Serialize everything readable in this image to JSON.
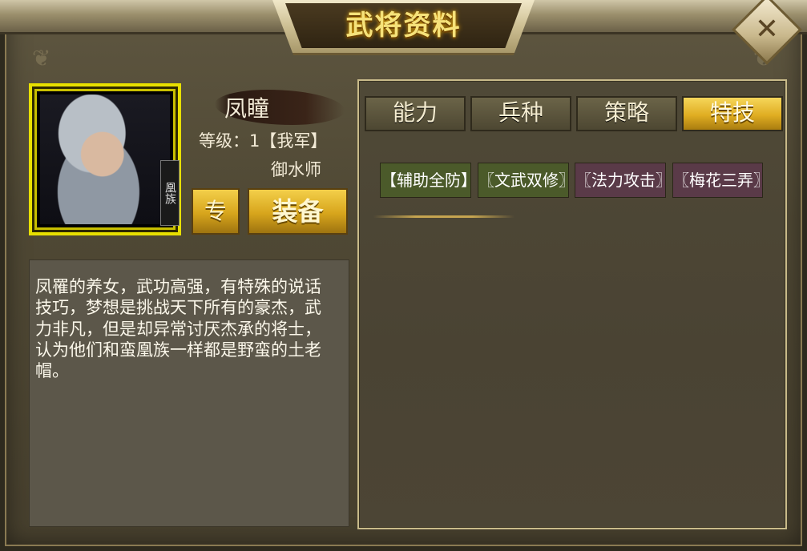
{
  "window": {
    "title": "武将资料",
    "close_icon": "close-x-icon"
  },
  "hero": {
    "name": "凤瞳",
    "level_text": "等级：1【我军】",
    "unit": "御水师",
    "portrait_tag": "凰族",
    "description": "凤罹的养女，武功高强，有特殊的说话技巧，梦想是挑战天下所有的豪杰，武力非凡，但是却异常讨厌杰承的将士，认为他们和蛮凰族一样都是野蛮的土老帽。"
  },
  "buttons": {
    "zhuan_label": "专",
    "equip_label": "装备"
  },
  "tabs": [
    {
      "label": "能力",
      "active": false
    },
    {
      "label": "兵种",
      "active": false
    },
    {
      "label": "策略",
      "active": false
    },
    {
      "label": "特技",
      "active": true
    }
  ],
  "skills": [
    {
      "label": "【辅助全防】",
      "color": "#4b5a2a"
    },
    {
      "label": "〖文武双修〗",
      "color": "#4b5a2a"
    },
    {
      "label": "〖法力攻击〗",
      "color": "#5a3a48"
    },
    {
      "label": "〖梅花三弄〗",
      "color": "#5a3a48"
    }
  ],
  "colors": {
    "accent_gold": "#e0ad22",
    "title_text": "#f6e27a",
    "frame_yellow": "#e8e000"
  }
}
